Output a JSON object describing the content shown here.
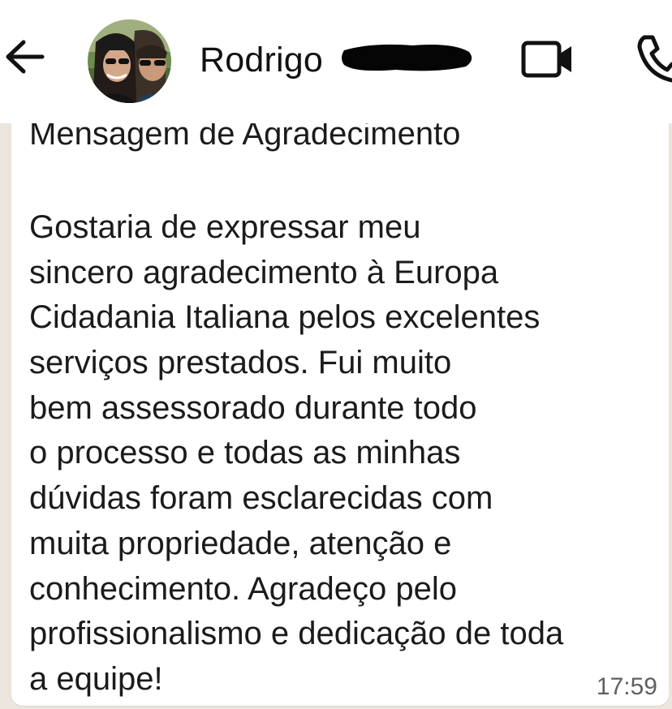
{
  "header": {
    "contact_name": "Rodrigo",
    "icons": {
      "back": "arrow-left-icon",
      "avatar": "contact-photo",
      "video": "video-camera-icon",
      "call": "phone-icon"
    }
  },
  "message": {
    "heading": "Mensagem de Agradecimento",
    "lines": [
      "Gostaria de expressar meu",
      "sincero agradecimento à Europa",
      "Cidadania Italiana pelos excelentes",
      "serviços prestados. Fui muito",
      "bem assessorado durante todo",
      "o processo e todas as minhas",
      "dúvidas foram esclarecidas com",
      "muita propriedade, atenção e",
      "conhecimento. Agradeço pelo",
      "profissionalismo e dedicação de toda",
      "a equipe!"
    ],
    "time": "17:59"
  },
  "colors": {
    "header_bg": "#ffffff",
    "chat_bg": "#ece5dd",
    "bubble_bg": "#ffffff",
    "text": "#1b1b1b",
    "time": "#5f5f5f"
  }
}
